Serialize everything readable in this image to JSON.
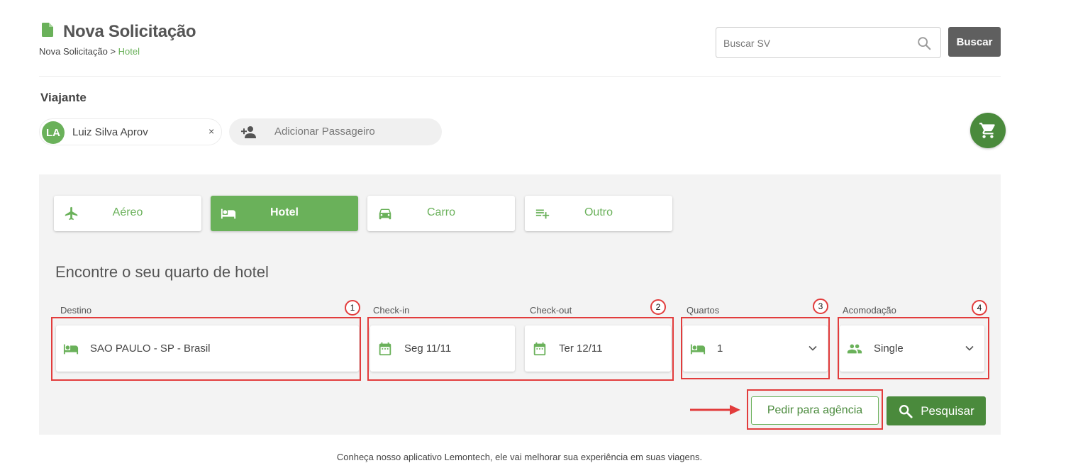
{
  "header": {
    "title": "Nova Solicitação",
    "breadcrumb": {
      "parent": "Nova Solicitação",
      "separator": " > ",
      "current": "Hotel"
    },
    "search": {
      "placeholder": "Buscar SV",
      "button_label": "Buscar"
    }
  },
  "travelers": {
    "title": "Viajante",
    "list": [
      {
        "initials": "LA",
        "name": "Luiz Silva Aprov",
        "remove": "×"
      }
    ],
    "add_label": "Adicionar Passageiro"
  },
  "tabs": [
    {
      "label": "Aéreo",
      "icon": "airplane-icon",
      "active": false
    },
    {
      "label": "Hotel",
      "icon": "bed-icon",
      "active": true
    },
    {
      "label": "Carro",
      "icon": "car-icon",
      "active": false
    },
    {
      "label": "Outro",
      "icon": "playlist-add-icon",
      "active": false
    }
  ],
  "form": {
    "heading": "Encontre o seu quarto de hotel",
    "destino": {
      "label": "Destino",
      "value": "SAO PAULO - SP - Brasil"
    },
    "checkin": {
      "label": "Check-in",
      "value": "Seg 11/11"
    },
    "checkout": {
      "label": "Check-out",
      "value": "Ter 12/11"
    },
    "quartos": {
      "label": "Quartos",
      "value": "1"
    },
    "acomodacao": {
      "label": "Acomodação",
      "value": "Single"
    },
    "pedir_label": "Pedir para agência",
    "pesquisar_label": "Pesquisar"
  },
  "annotations": {
    "badges": [
      "1",
      "2",
      "3",
      "4"
    ]
  },
  "footer": {
    "text": "Conheça nosso aplicativo Lemontech, ele vai melhorar sua experiência em suas viagens."
  },
  "colors": {
    "accent": "#6ab15a",
    "accent_dark": "#4a8a3c",
    "annotation": "#e23c3c"
  }
}
